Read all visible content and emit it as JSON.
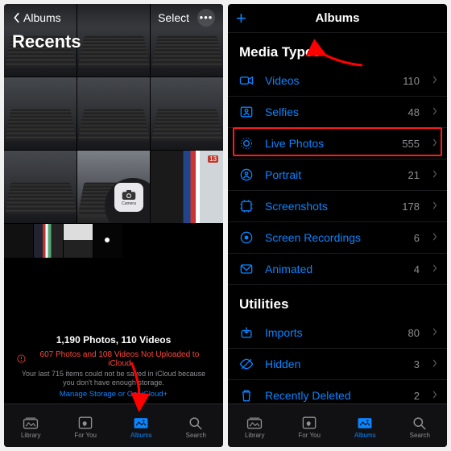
{
  "left": {
    "back_label": "Albums",
    "select_label": "Select",
    "album_title": "Recents",
    "camera_app": "Camera",
    "colorful_badge": "13",
    "summary_count": "1,190 Photos, 110 Videos",
    "warn_line": "607 Photos and 108 Videos Not Uploaded to iCloud",
    "warn_sub1": "Your last 715 items could not be saved in iCloud because",
    "warn_sub2": "you don't have enough storage.",
    "warn_link": "Manage Storage or Get iCloud+"
  },
  "right": {
    "title": "Albums",
    "section_media": "Media Types",
    "section_util": "Utilities",
    "media": [
      {
        "label": "Videos",
        "count": "110"
      },
      {
        "label": "Selfies",
        "count": "48"
      },
      {
        "label": "Live Photos",
        "count": "555"
      },
      {
        "label": "Portrait",
        "count": "21"
      },
      {
        "label": "Screenshots",
        "count": "178"
      },
      {
        "label": "Screen Recordings",
        "count": "6"
      },
      {
        "label": "Animated",
        "count": "4"
      }
    ],
    "util": [
      {
        "label": "Imports",
        "count": "80"
      },
      {
        "label": "Hidden",
        "count": "3"
      },
      {
        "label": "Recently Deleted",
        "count": "2"
      }
    ]
  },
  "tabs": {
    "library": "Library",
    "foryou": "For You",
    "albums": "Albums",
    "search": "Search"
  }
}
